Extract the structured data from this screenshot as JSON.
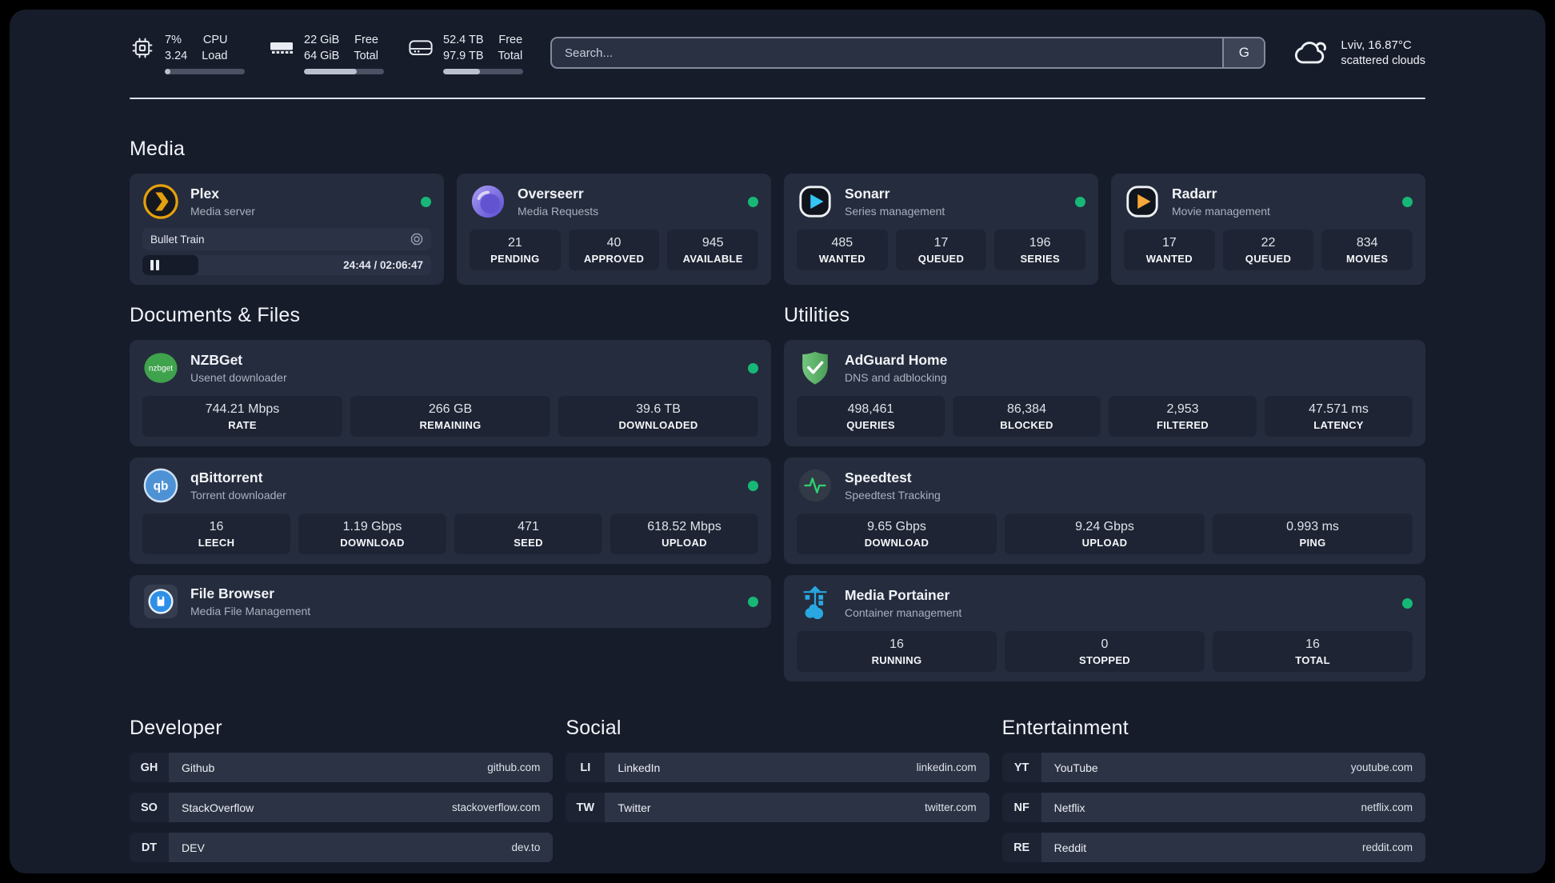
{
  "colors": {
    "status_online": "#17b877",
    "plex": "#e5a00d",
    "overseerr": "#7b6ce0",
    "sonarr": "#35c5f4",
    "radarr": "#f7a83a",
    "nzbget": "#3fa24c",
    "qbittorrent": "#4e92d6",
    "filebrowser": "#2e8fe8",
    "adguard": "#5cb470",
    "speedtest": "#2dd36f",
    "portainer": "#29a7e0"
  },
  "header": {
    "system_stats": [
      {
        "icon": "cpu-icon",
        "v1": "7%",
        "v2": "3.24",
        "l1": "CPU",
        "l2": "Load",
        "progress_pct": 7
      },
      {
        "icon": "ram-icon",
        "v1": "22 GiB",
        "v2": "64 GiB",
        "l1": "Free",
        "l2": "Total",
        "progress_pct": 66
      },
      {
        "icon": "disk-icon",
        "v1": "52.4 TB",
        "v2": "97.9 TB",
        "l1": "Free",
        "l2": "Total",
        "progress_pct": 46
      }
    ],
    "search": {
      "placeholder": "Search...",
      "provider": "G"
    },
    "weather": {
      "line1": "Lviv, 16.87°C",
      "line2": "scattered clouds"
    }
  },
  "media": {
    "title": "Media",
    "cards": [
      {
        "title": "Plex",
        "subtitle": "Media server",
        "online": true,
        "now_playing": {
          "track": "Bullet Train",
          "time": "24:44 / 02:06:47",
          "progress_pct": 19.5
        }
      },
      {
        "title": "Overseerr",
        "subtitle": "Media Requests",
        "online": true,
        "stats": [
          {
            "value": "21",
            "label": "PENDING"
          },
          {
            "value": "40",
            "label": "APPROVED"
          },
          {
            "value": "945",
            "label": "AVAILABLE"
          }
        ]
      },
      {
        "title": "Sonarr",
        "subtitle": "Series management",
        "online": true,
        "stats": [
          {
            "value": "485",
            "label": "WANTED"
          },
          {
            "value": "17",
            "label": "QUEUED"
          },
          {
            "value": "196",
            "label": "SERIES"
          }
        ]
      },
      {
        "title": "Radarr",
        "subtitle": "Movie management",
        "online": true,
        "stats": [
          {
            "value": "17",
            "label": "WANTED"
          },
          {
            "value": "22",
            "label": "QUEUED"
          },
          {
            "value": "834",
            "label": "MOVIES"
          }
        ]
      }
    ]
  },
  "documents": {
    "title": "Documents & Files",
    "cards": [
      {
        "title": "NZBGet",
        "subtitle": "Usenet downloader",
        "online": true,
        "icon_text": "nzbget",
        "stats": [
          {
            "value": "744.21 Mbps",
            "label": "RATE"
          },
          {
            "value": "266 GB",
            "label": "REMAINING"
          },
          {
            "value": "39.6 TB",
            "label": "DOWNLOADED"
          }
        ]
      },
      {
        "title": "qBittorrent",
        "subtitle": "Torrent downloader",
        "online": true,
        "icon_text": "qb",
        "stats": [
          {
            "value": "16",
            "label": "LEECH"
          },
          {
            "value": "1.19 Gbps",
            "label": "DOWNLOAD"
          },
          {
            "value": "471",
            "label": "SEED"
          },
          {
            "value": "618.52 Mbps",
            "label": "UPLOAD"
          }
        ]
      },
      {
        "title": "File Browser",
        "subtitle": "Media File Management",
        "online": true
      }
    ]
  },
  "utilities": {
    "title": "Utilities",
    "cards": [
      {
        "title": "AdGuard Home",
        "subtitle": "DNS and adblocking",
        "stats": [
          {
            "value": "498,461",
            "label": "QUERIES"
          },
          {
            "value": "86,384",
            "label": "BLOCKED"
          },
          {
            "value": "2,953",
            "label": "FILTERED"
          },
          {
            "value": "47.571 ms",
            "label": "LATENCY"
          }
        ]
      },
      {
        "title": "Speedtest",
        "subtitle": "Speedtest Tracking",
        "stats": [
          {
            "value": "9.65 Gbps",
            "label": "DOWNLOAD"
          },
          {
            "value": "9.24 Gbps",
            "label": "UPLOAD"
          },
          {
            "value": "0.993 ms",
            "label": "PING"
          }
        ]
      },
      {
        "title": "Media Portainer",
        "subtitle": "Container management",
        "online": true,
        "stats": [
          {
            "value": "16",
            "label": "RUNNING"
          },
          {
            "value": "0",
            "label": "STOPPED"
          },
          {
            "value": "16",
            "label": "TOTAL"
          }
        ]
      }
    ]
  },
  "links": {
    "developer": {
      "title": "Developer",
      "items": [
        {
          "abbr": "GH",
          "name": "Github",
          "url": "github.com"
        },
        {
          "abbr": "SO",
          "name": "StackOverflow",
          "url": "stackoverflow.com"
        },
        {
          "abbr": "DT",
          "name": "DEV",
          "url": "dev.to"
        }
      ]
    },
    "social": {
      "title": "Social",
      "items": [
        {
          "abbr": "LI",
          "name": "LinkedIn",
          "url": "linkedin.com"
        },
        {
          "abbr": "TW",
          "name": "Twitter",
          "url": "twitter.com"
        }
      ]
    },
    "entertainment": {
      "title": "Entertainment",
      "items": [
        {
          "abbr": "YT",
          "name": "YouTube",
          "url": "youtube.com"
        },
        {
          "abbr": "NF",
          "name": "Netflix",
          "url": "netflix.com"
        },
        {
          "abbr": "RE",
          "name": "Reddit",
          "url": "reddit.com"
        }
      ]
    }
  }
}
